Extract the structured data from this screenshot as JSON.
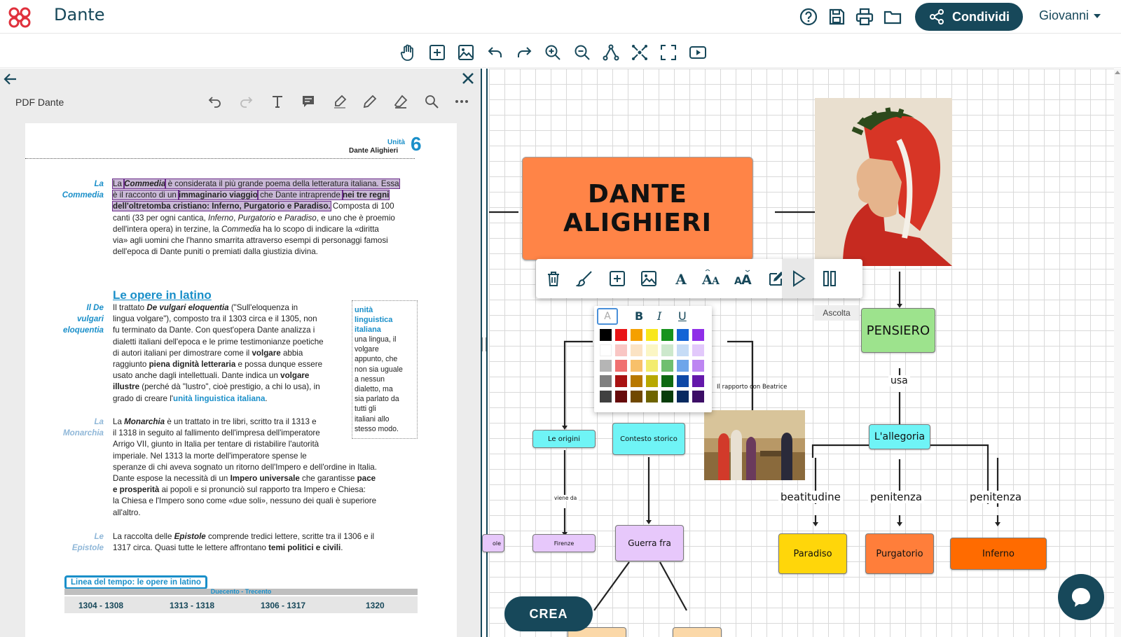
{
  "app": {
    "title": "Dante"
  },
  "header": {
    "share_label": "Condividi",
    "user_name": "Giovanni"
  },
  "left_panel": {
    "pdf_title": "PDF Dante"
  },
  "pdf": {
    "unit_label": "Unità",
    "unit_author": "Dante Alighieri",
    "unit_number": "6",
    "sec1_side": [
      "La",
      "Commedia"
    ],
    "sec1_lines": [
      [
        "La ",
        "Commedia",
        " è considerata il più grande poema della letteratura italiana. Essa"
      ],
      [
        "è il racconto di un ",
        "immaginario viaggio",
        " che Dante intraprende ",
        "nei tre regni"
      ],
      [
        "dell'oltretomba cristiano: Inferno, Purgatorio e Paradiso.",
        " Composta di 100"
      ],
      [
        "canti (33 per ogni cantica, ",
        "Inferno",
        ", ",
        "Purgatorio",
        " e ",
        "Paradiso",
        ", e uno che è proemio"
      ],
      [
        "dell'intera opera) in terzine, la ",
        "Commedia",
        " ha lo scopo di indicare la «diritta"
      ],
      [
        "via» agli uomini che l'hanno smarrita attraverso esempi di personaggi famosi"
      ],
      [
        "dell'epoca di Dante puniti o premiati dalla giustizia divina."
      ]
    ],
    "heading_latin": "Le opere in latino",
    "sec2_side": [
      "Il De",
      "vulgari",
      "eloquentia"
    ],
    "sec2_lines": [
      [
        "Il trattato ",
        "De vulgari eloquentia",
        " (\"Sull'eloquenza in"
      ],
      [
        "lingua volgare\"), composto tra il 1303 circa e il 1305, non"
      ],
      [
        "fu terminato da Dante. Con quest'opera Dante analizza i"
      ],
      [
        "dialetti italiani dell'epoca e le prime testimonianze poetiche"
      ],
      [
        "di autori italiani per dimostrare come il ",
        "volgare",
        " abbia"
      ],
      [
        "raggiunto ",
        "piena dignità letteraria",
        " e possa dunque essere"
      ],
      [
        "usato anche dagli intellettuali. Dante indica un ",
        "volgare"
      ],
      [
        "illustre",
        " (perché dà \"lustro\", cioè prestigio, a chi lo usa), in"
      ],
      [
        "grado di creare l'",
        "unità linguistica italiana",
        "."
      ]
    ],
    "box_title": [
      "unità",
      "linguistica",
      "italiana"
    ],
    "box_lines": [
      "una lingua, il",
      "volgare",
      "appunto, che",
      "non sia uguale",
      "a nessun",
      "dialetto, ma",
      "sia parlato da",
      "tutti gli",
      "italiani allo",
      "stesso modo."
    ],
    "sec3_side": [
      "La",
      "Monarchia"
    ],
    "sec3_lines": [
      [
        "La ",
        "Monarchia",
        " è un trattato in tre libri, scritto tra il 1313 e"
      ],
      [
        "il 1318 in seguito al fallimento dell'impresa dell'imperatore"
      ],
      [
        "Arrigo VII, giunto in Italia per tentare di ristabilire l'autorità"
      ],
      [
        "imperiale. Nel 1313 la morte dell'imperatore spense le"
      ],
      [
        "speranze di chi aveva sognato un ritorno dell'Impero e dell'ordine in Italia."
      ],
      [
        "Dante espose la necessità di un ",
        "Impero universale",
        " che garantisse ",
        "pace"
      ],
      [
        "e prosperità",
        " ai popoli e si pronunciò sul rapporto tra Impero e Chiesa:"
      ],
      [
        "la Chiesa e l'Impero sono come «due soli», nessuno dei quali è superiore"
      ],
      [
        "all'altro."
      ]
    ],
    "sec4_side": [
      "Le",
      "Epistole"
    ],
    "sec4_lines": [
      [
        "La raccolta delle ",
        "Epistole",
        " comprende tredici lettere, scritte tra il 1306 e il"
      ],
      [
        "1317 circa. Quasi tutte le lettere affrontano ",
        "temi politici e civili",
        "."
      ]
    ],
    "timeline_title": "Linea del tempo: le opere in latino",
    "timeline_band": "Duecento - Trecento",
    "timeline_years": [
      "1304 - 1308",
      "1313 - 1318",
      "1306 - 1317",
      "1320"
    ]
  },
  "map": {
    "main_node": "DANTE ALIGHIERI",
    "pensiero": "PENSIERO",
    "usa": "usa",
    "allegoria": "L'allegoria",
    "beatitudine": "beatitudine",
    "penitenza_1": "penitenza",
    "penitenza_2": "penitenza",
    "paradiso": "Paradiso",
    "purgatorio": "Purgatorio",
    "inferno": "Inferno",
    "origini": "Le origini",
    "contesto": "Contesto storico",
    "rapporto": "Il rapporto con Beatrice",
    "viene_da": "viene da",
    "firenze": "Firenze",
    "guerra": "Guerra fra",
    "partial_left": "ole",
    "tooltip": "Ascolta",
    "crea": "CREA"
  },
  "color_picker": {
    "tabs": [
      "A",
      "B",
      "I",
      "U"
    ],
    "rows": [
      [
        "#000000",
        "#e81416",
        "#f5a000",
        "#f8e71c",
        "#17931d",
        "#1464d6",
        "#8f2ee8"
      ],
      [
        "#ffffff",
        "#f9c6c4",
        "#fbe3c4",
        "#fbf6c4",
        "#cce8cc",
        "#c6dcf6",
        "#e2c9fb"
      ],
      [
        "#b5b5b5",
        "#f07070",
        "#f8c06a",
        "#f3ec6e",
        "#6fbf6f",
        "#6ea5ea",
        "#bd86f2"
      ],
      [
        "#808080",
        "#a81212",
        "#b87800",
        "#b8a800",
        "#0f6a12",
        "#0e48a6",
        "#6418aa"
      ],
      [
        "#404040",
        "#660a0a",
        "#704800",
        "#6e6400",
        "#083d0a",
        "#082a60",
        "#3c0e66"
      ]
    ]
  },
  "colors": {
    "brand": "#17485a",
    "accent_blue": "#1a8fc9",
    "main_node": "#ff8447",
    "pensiero": "#9de38d",
    "cyan": "#6ff4f6",
    "lilac": "#e7c8fb",
    "yellow": "#ffd60a",
    "orange": "#ff7e3a",
    "orange_dark": "#ff6b00"
  }
}
